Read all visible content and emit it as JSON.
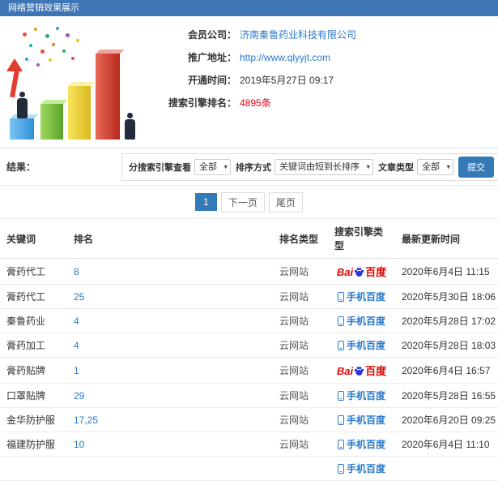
{
  "colors": {
    "header_bg": "#3e75b5",
    "link": "#2a7ac9",
    "red": "#e60012",
    "button": "#337ab7",
    "baidu_red": "#e10601",
    "baidu_blue": "#2932e1",
    "mobile_blue": "#2a7ac9"
  },
  "header": {
    "title": "网络营销效果展示"
  },
  "info": {
    "fields": [
      {
        "label": "会员公司：",
        "value": "济南秦鲁药业科技有限公司"
      },
      {
        "label": "推广地址：",
        "value": "http://www.qlyyjt.com"
      },
      {
        "label": "开通时间：",
        "value": "2019年5月27日 09:17"
      },
      {
        "label": "搜索引擎排名：",
        "value": "4895条"
      }
    ]
  },
  "filters": {
    "result_label": "结果：",
    "engine_label": "分搜索引擎查看",
    "engine_value": "全部",
    "sort_label": "排序方式",
    "sort_value": "关键词由短到长排序",
    "article_label": "文章类型",
    "article_value": "全部",
    "submit_label": "提交"
  },
  "pagination": {
    "current": "1",
    "next": "下一页",
    "last": "尾页"
  },
  "logos": {
    "baidu_bai": "Bai",
    "baidu_du": "百度",
    "mobile": "手机百度"
  },
  "table": {
    "headers": [
      "关键词",
      "排名",
      "排名类型",
      "搜索引擎类型",
      "最新更新时间"
    ],
    "rows": [
      {
        "keyword": "膏药代工",
        "rank": "8",
        "rank_type": "云网站",
        "engine": "baidu",
        "updated": "2020年6月4日 11:15"
      },
      {
        "keyword": "膏药代工",
        "rank": "25",
        "rank_type": "云网站",
        "engine": "mobile",
        "updated": "2020年5月30日 18:06"
      },
      {
        "keyword": "秦鲁药业",
        "rank": "4",
        "rank_type": "云网站",
        "engine": "mobile",
        "updated": "2020年5月28日 17:02"
      },
      {
        "keyword": "膏药加工",
        "rank": "4",
        "rank_type": "云网站",
        "engine": "mobile",
        "updated": "2020年5月28日 18:03"
      },
      {
        "keyword": "膏药贴牌",
        "rank": "1",
        "rank_type": "云网站",
        "engine": "baidu",
        "updated": "2020年6月4日 16:57"
      },
      {
        "keyword": "口罩贴牌",
        "rank": "29",
        "rank_type": "云网站",
        "engine": "mobile",
        "updated": "2020年5月28日 16:55"
      },
      {
        "keyword": "金华防护服",
        "rank": "17,25",
        "rank_type": "云网站",
        "engine": "mobile",
        "updated": "2020年6月20日 09:25"
      },
      {
        "keyword": "福建防护服",
        "rank": "10",
        "rank_type": "云网站",
        "engine": "mobile",
        "updated": "2020年6月4日 11:10"
      }
    ],
    "partial_row": {
      "engine": "mobile"
    }
  }
}
